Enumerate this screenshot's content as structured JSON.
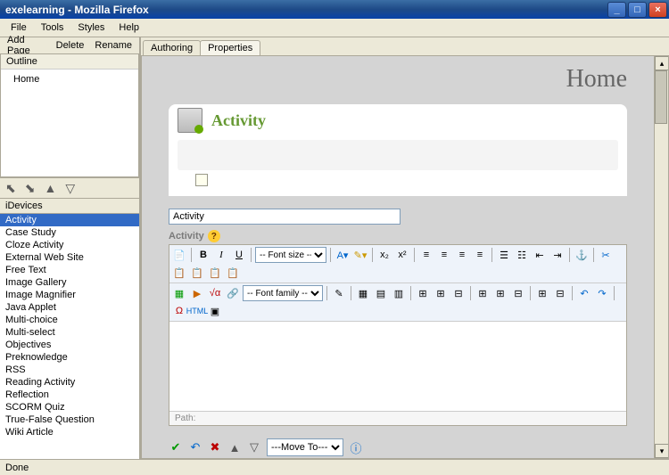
{
  "window": {
    "title": "exelearning - Mozilla Firefox"
  },
  "menubar": [
    "File",
    "Tools",
    "Styles",
    "Help"
  ],
  "page_toolbar": [
    "Add Page",
    "Delete",
    "Rename"
  ],
  "outline": {
    "header": "Outline",
    "items": [
      "Home"
    ]
  },
  "idevices": {
    "header": "iDevices",
    "items": [
      "Activity",
      "Case Study",
      "Cloze Activity",
      "External Web Site",
      "Free Text",
      "Image Gallery",
      "Image Magnifier",
      "Java Applet",
      "Multi-choice",
      "Multi-select",
      "Objectives",
      "Preknowledge",
      "RSS",
      "Reading Activity",
      "Reflection",
      "SCORM Quiz",
      "True-False Question",
      "Wiki Article"
    ],
    "selected": 0
  },
  "tabs": {
    "authoring": "Authoring",
    "properties": "Properties"
  },
  "page": {
    "title": "Home",
    "activity_label": "Activity",
    "title_field_value": "Activity",
    "section_label": "Activity",
    "path_label": "Path:"
  },
  "editor": {
    "font_size": "-- Font size --",
    "font_family": "-- Font family --",
    "html_label": "HTML"
  },
  "actions": {
    "move_to": "---Move To---"
  },
  "statusbar": "Done"
}
